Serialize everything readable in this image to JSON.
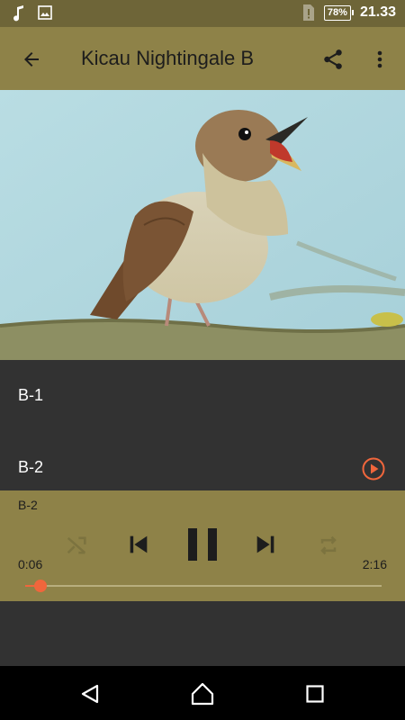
{
  "status_bar": {
    "icons": [
      "music-note-icon",
      "image-icon",
      "sim-alert-icon"
    ],
    "battery": "78%",
    "time": "21.33"
  },
  "app_bar": {
    "title": "Kicau Nightingale B",
    "back_icon": "arrow-back-icon",
    "share_icon": "share-icon",
    "menu_icon": "more-vert-icon"
  },
  "tracks": [
    {
      "label": "B-1"
    },
    {
      "label": "B-2",
      "playing": true
    }
  ],
  "player": {
    "now_playing": "B-2",
    "elapsed": "0:06",
    "duration": "2:16",
    "progress": 0.044,
    "controls": [
      "shuffle-icon",
      "skip-previous-icon",
      "pause-icon",
      "skip-next-icon",
      "repeat-icon"
    ]
  },
  "colors": {
    "accent": "#f0663c",
    "bar": "#8e8248",
    "status": "#6e6538"
  }
}
